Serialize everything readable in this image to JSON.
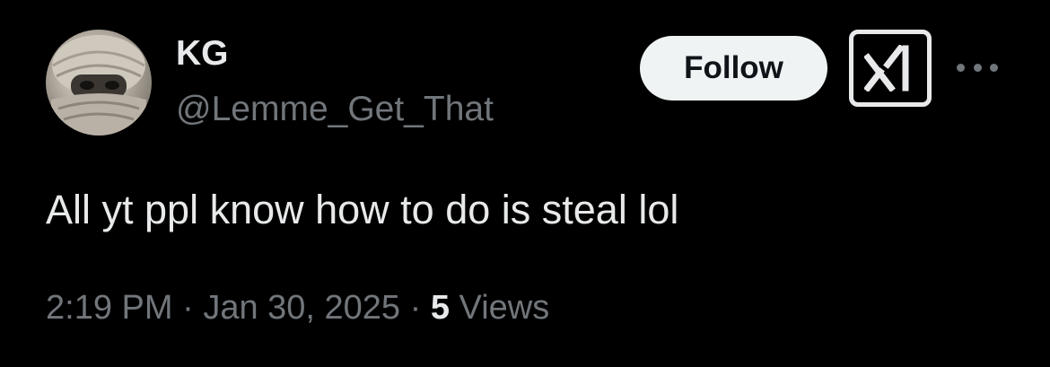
{
  "user": {
    "display_name": "KG",
    "handle": "@Lemme_Get_That",
    "avatar_icon": "avatar-photo"
  },
  "actions": {
    "follow_label": "Follow",
    "grok_icon": "grok-icon",
    "more_icon": "more-icon"
  },
  "tweet": {
    "text": "All yt ppl know how to do is steal lol",
    "time": "2:19 PM",
    "separator": "·",
    "date": "Jan 30, 2025",
    "views_count": "5",
    "views_label": "Views"
  },
  "colors": {
    "background": "#000000",
    "primary_text": "#e7e9ea",
    "secondary_text": "#71767b",
    "follow_button_bg": "#eff3f4",
    "follow_button_text": "#0f1419"
  }
}
